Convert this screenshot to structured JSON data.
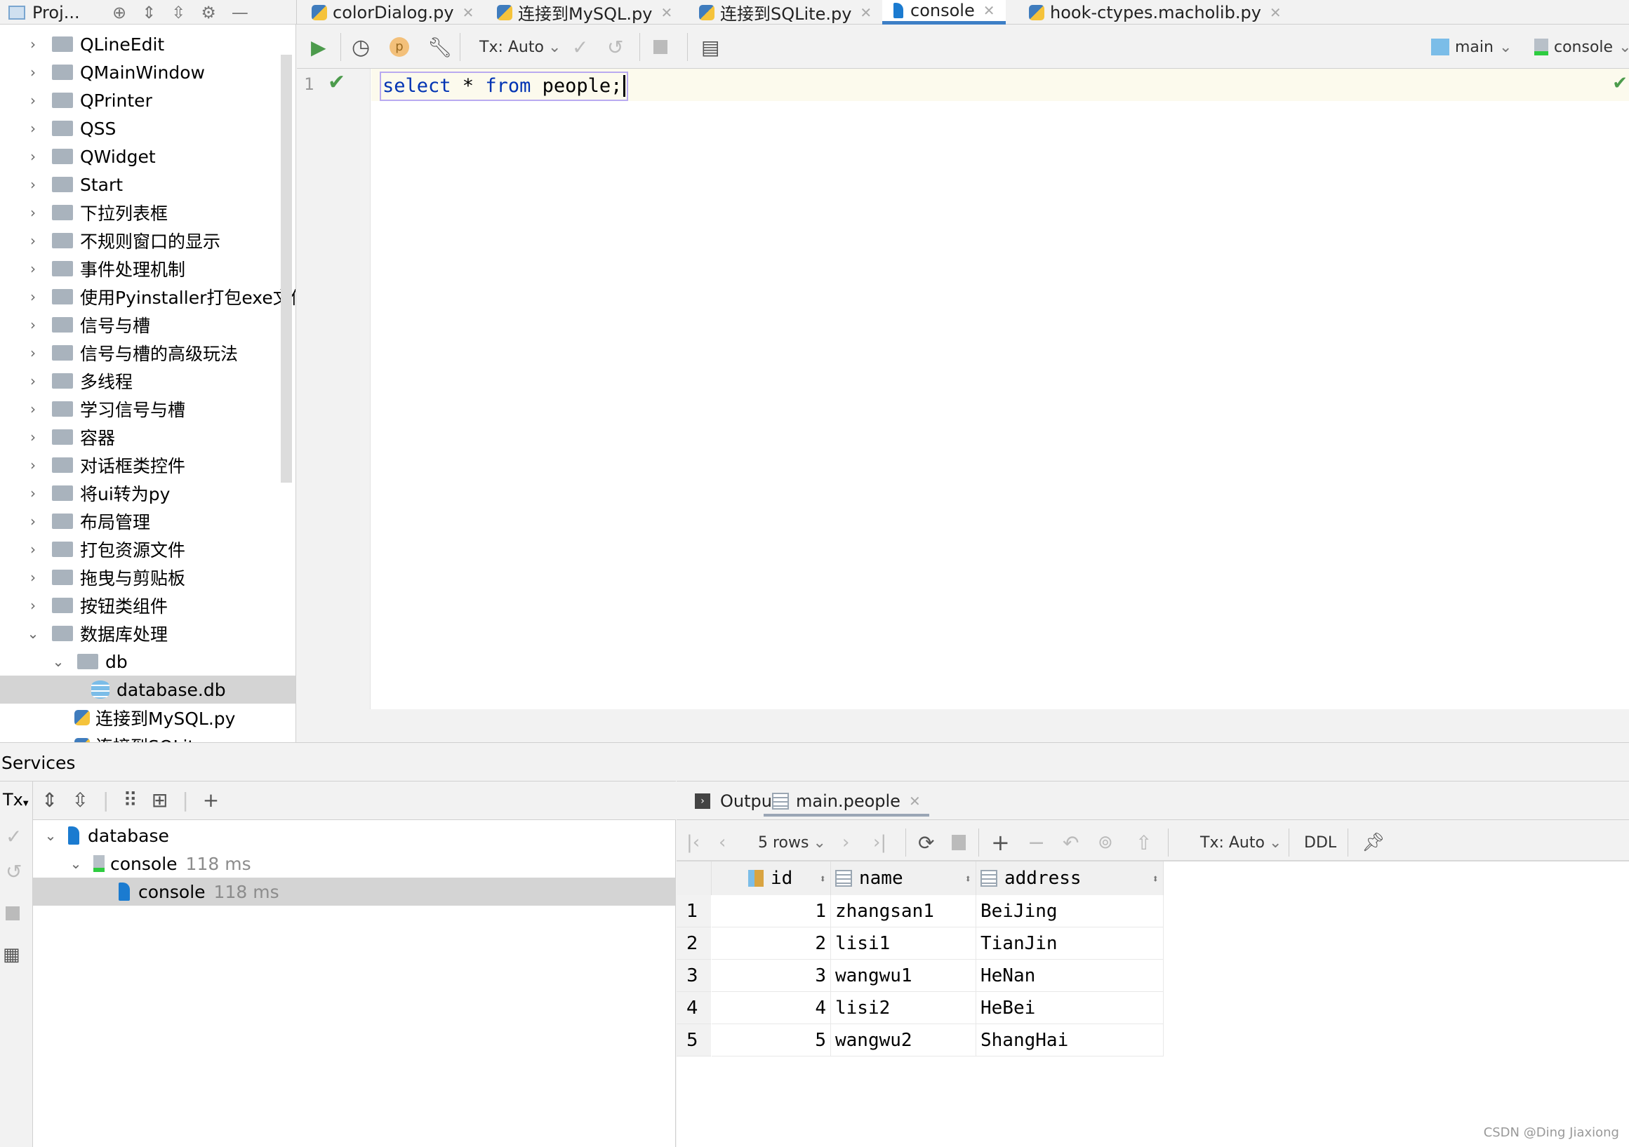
{
  "tabs": [
    {
      "label": "colorDialog.py",
      "icon": "python-file-icon"
    },
    {
      "label": "连接到MySQL.py",
      "icon": "python-file-icon"
    },
    {
      "label": "连接到SQLite.py",
      "icon": "python-file-icon"
    },
    {
      "label": "console",
      "icon": "sqlite-console-icon",
      "active": true
    },
    {
      "label": "hook-ctypes.macholib.py",
      "icon": "python-file-icon"
    }
  ],
  "project": {
    "title": "Proj...",
    "items": [
      {
        "label": "QLineEdit"
      },
      {
        "label": "QMainWindow"
      },
      {
        "label": "QPrinter"
      },
      {
        "label": "QSS"
      },
      {
        "label": "QWidget"
      },
      {
        "label": "Start"
      },
      {
        "label": "下拉列表框"
      },
      {
        "label": "不规则窗口的显示"
      },
      {
        "label": "事件处理机制"
      },
      {
        "label": "使用Pyinstaller打包exe文件"
      },
      {
        "label": "信号与槽"
      },
      {
        "label": "信号与槽的高级玩法"
      },
      {
        "label": "多线程"
      },
      {
        "label": "学习信号与槽"
      },
      {
        "label": "容器"
      },
      {
        "label": "对话框类控件"
      },
      {
        "label": "将ui转为py"
      },
      {
        "label": "布局管理"
      },
      {
        "label": "打包资源文件"
      },
      {
        "label": "拖曳与剪贴板"
      },
      {
        "label": "按钮类组件"
      },
      {
        "label": "数据库处理",
        "expanded": true
      },
      {
        "label": "db",
        "expanded": true
      },
      {
        "label": "database.db",
        "selected": true
      },
      {
        "label": "连接到MySQL.py"
      },
      {
        "label": "连接到SQLite.py"
      }
    ]
  },
  "toolbar": {
    "tx": "Tx: Auto",
    "schema": "main",
    "session": "console"
  },
  "editor": {
    "line_number": "1",
    "code_kw1": "select",
    "code_mid": " * ",
    "code_kw2": "from",
    "code_rest": " people;"
  },
  "services": {
    "title": "Services",
    "tx": "Tx",
    "tree": [
      {
        "label": "database",
        "time": ""
      },
      {
        "label": "console",
        "time": "118 ms"
      },
      {
        "label": "console",
        "time": "118 ms",
        "selected": true
      }
    ]
  },
  "results": {
    "tabs": [
      {
        "label": "Output"
      },
      {
        "label": "main.people",
        "active": true
      }
    ],
    "rows_label": "5 rows",
    "tx": "Tx: Auto",
    "ddl": "DDL",
    "columns": [
      "id",
      "name",
      "address"
    ],
    "rows": [
      [
        "1",
        "zhangsan1",
        "BeiJing"
      ],
      [
        "2",
        "lisi1",
        "TianJin"
      ],
      [
        "3",
        "wangwu1",
        "HeNan"
      ],
      [
        "4",
        "lisi2",
        "HeBei"
      ],
      [
        "5",
        "wangwu2",
        "ShangHai"
      ]
    ]
  },
  "watermark": "CSDN @Ding Jiaxiong",
  "colors": {
    "accent": "#3d7fc6",
    "keyword": "#0033b3",
    "run": "#4c9b4c"
  }
}
